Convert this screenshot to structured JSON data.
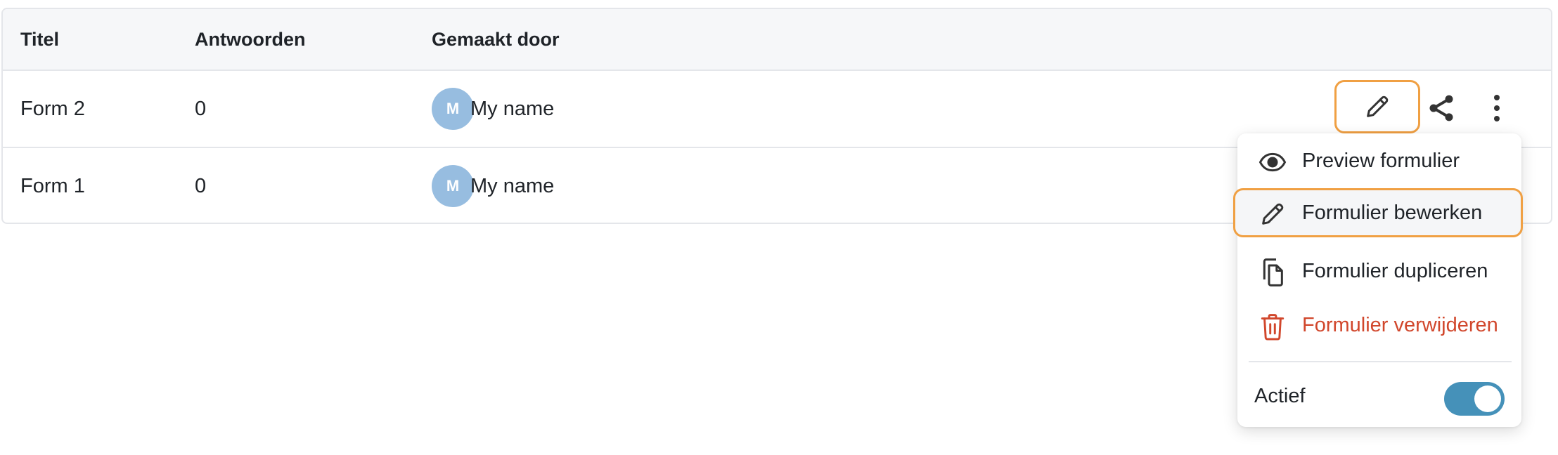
{
  "table": {
    "headers": [
      "Titel",
      "Antwoorden",
      "Gemaakt door"
    ],
    "rows": [
      {
        "title": "Form 2",
        "answers": "0",
        "author_initial": "M",
        "author": "My name"
      },
      {
        "title": "Form 1",
        "answers": "0",
        "author_initial": "M",
        "author": "My name"
      }
    ]
  },
  "row_actions": {
    "edit_icon": "pencil-icon",
    "share_icon": "share-icon",
    "more_icon": "vertical-dots-icon"
  },
  "menu": {
    "items": [
      {
        "label": "Preview formulier",
        "icon": "eye-icon"
      },
      {
        "label": "Formulier bewerken",
        "icon": "pencil-icon"
      },
      {
        "label": "Formulier dupliceren",
        "icon": "copy-icon"
      },
      {
        "label": "Formulier verwijderen",
        "icon": "trash-icon"
      }
    ],
    "toggle_label": "Actief",
    "toggle_on": true
  },
  "colors": {
    "highlight": "#f0a043",
    "danger": "#d1472c",
    "toggle": "#4591b9",
    "avatar": "#97bde0"
  }
}
